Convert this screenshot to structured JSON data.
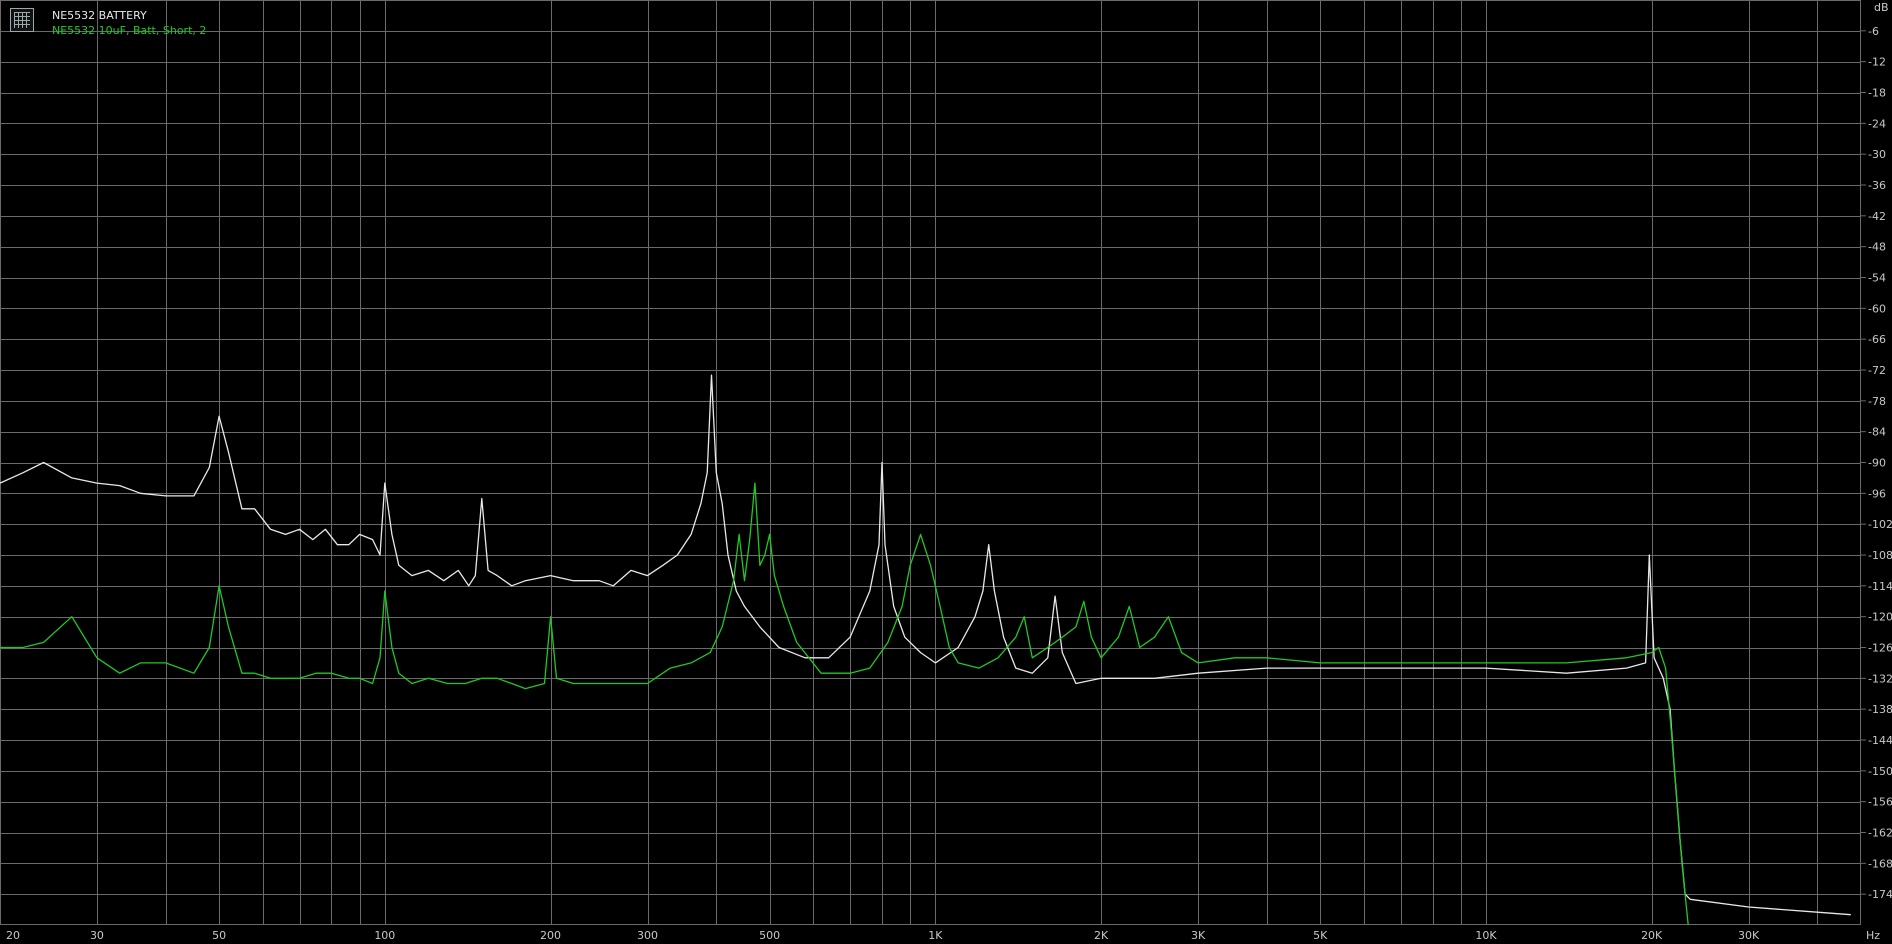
{
  "app": {
    "logo_icon": "grid-logo-icon"
  },
  "legend": {
    "series1": "NE5532 BATTERY",
    "series2": "NE5532 10uF, Batt, Short, 2"
  },
  "colors": {
    "background": "#000000",
    "grid": "#6a6a6a",
    "series1": "#e8e8e8",
    "series2": "#22c822",
    "tick_text": "#c8c8c8"
  },
  "chart_data": {
    "type": "line",
    "x_scale": "log",
    "xlim": [
      20,
      48000
    ],
    "ylim": [
      -180,
      0
    ],
    "x_unit": "Hz",
    "y_unit": "dB",
    "xticks": [
      {
        "v": 20,
        "label": "20"
      },
      {
        "v": 30,
        "label": "30"
      },
      {
        "v": 50,
        "label": "50"
      },
      {
        "v": 100,
        "label": "100"
      },
      {
        "v": 200,
        "label": "200"
      },
      {
        "v": 300,
        "label": "300"
      },
      {
        "v": 500,
        "label": "500"
      },
      {
        "v": 1000,
        "label": "1K"
      },
      {
        "v": 2000,
        "label": "2K"
      },
      {
        "v": 3000,
        "label": "3K"
      },
      {
        "v": 5000,
        "label": "5K"
      },
      {
        "v": 10000,
        "label": "10K"
      },
      {
        "v": 20000,
        "label": "20K"
      },
      {
        "v": 30000,
        "label": "30K"
      }
    ],
    "yticks": [
      -6,
      -12,
      -18,
      -24,
      -30,
      -36,
      -42,
      -48,
      -54,
      -60,
      -66,
      -72,
      -78,
      -84,
      -90,
      -96,
      -102,
      -108,
      -114,
      -120,
      -126,
      -132,
      -138,
      -144,
      -150,
      -156,
      -162,
      -168,
      -174
    ],
    "grid": true,
    "series": [
      {
        "name": "NE5532 BATTERY",
        "color": "#e8e8e8",
        "points": [
          [
            20,
            -94
          ],
          [
            22,
            -92
          ],
          [
            24,
            -90
          ],
          [
            27,
            -93
          ],
          [
            30,
            -94
          ],
          [
            33,
            -94.5
          ],
          [
            36,
            -96
          ],
          [
            40,
            -96.5
          ],
          [
            45,
            -96.5
          ],
          [
            48,
            -91
          ],
          [
            50,
            -81
          ],
          [
            52,
            -88
          ],
          [
            55,
            -99
          ],
          [
            58,
            -99
          ],
          [
            62,
            -103
          ],
          [
            66,
            -104
          ],
          [
            70,
            -103
          ],
          [
            74,
            -105
          ],
          [
            78,
            -103
          ],
          [
            82,
            -106
          ],
          [
            86,
            -106
          ],
          [
            90,
            -104
          ],
          [
            95,
            -105
          ],
          [
            98,
            -108
          ],
          [
            100,
            -94
          ],
          [
            103,
            -104
          ],
          [
            106,
            -110
          ],
          [
            112,
            -112
          ],
          [
            120,
            -111
          ],
          [
            128,
            -113
          ],
          [
            136,
            -111
          ],
          [
            142,
            -114
          ],
          [
            146,
            -112
          ],
          [
            150,
            -97
          ],
          [
            154,
            -111
          ],
          [
            160,
            -112
          ],
          [
            170,
            -114
          ],
          [
            180,
            -113
          ],
          [
            200,
            -112
          ],
          [
            220,
            -113
          ],
          [
            245,
            -113
          ],
          [
            260,
            -114
          ],
          [
            280,
            -111
          ],
          [
            300,
            -112
          ],
          [
            320,
            -110
          ],
          [
            340,
            -108
          ],
          [
            360,
            -104
          ],
          [
            375,
            -98
          ],
          [
            385,
            -92
          ],
          [
            392,
            -73
          ],
          [
            400,
            -92
          ],
          [
            410,
            -98
          ],
          [
            420,
            -108
          ],
          [
            435,
            -115
          ],
          [
            450,
            -118
          ],
          [
            480,
            -122
          ],
          [
            520,
            -126
          ],
          [
            580,
            -128
          ],
          [
            640,
            -128
          ],
          [
            700,
            -124
          ],
          [
            760,
            -115
          ],
          [
            790,
            -106
          ],
          [
            800,
            -90
          ],
          [
            810,
            -106
          ],
          [
            840,
            -118
          ],
          [
            880,
            -124
          ],
          [
            940,
            -127
          ],
          [
            1000,
            -129
          ],
          [
            1100,
            -126
          ],
          [
            1180,
            -120
          ],
          [
            1220,
            -115
          ],
          [
            1250,
            -106
          ],
          [
            1280,
            -115
          ],
          [
            1330,
            -124
          ],
          [
            1400,
            -130
          ],
          [
            1500,
            -131
          ],
          [
            1600,
            -128
          ],
          [
            1650,
            -116
          ],
          [
            1700,
            -127
          ],
          [
            1800,
            -133
          ],
          [
            2000,
            -132
          ],
          [
            2500,
            -132
          ],
          [
            3000,
            -131
          ],
          [
            4000,
            -130
          ],
          [
            5000,
            -130
          ],
          [
            7000,
            -130
          ],
          [
            10000,
            -130
          ],
          [
            14000,
            -131
          ],
          [
            18000,
            -130
          ],
          [
            19500,
            -129
          ],
          [
            19800,
            -108
          ],
          [
            20200,
            -128
          ],
          [
            21000,
            -132
          ],
          [
            21600,
            -138
          ],
          [
            22000,
            -150
          ],
          [
            22500,
            -163
          ],
          [
            23000,
            -174
          ],
          [
            23500,
            -175
          ],
          [
            30000,
            -176.5
          ],
          [
            40000,
            -177.5
          ],
          [
            46000,
            -178
          ]
        ]
      },
      {
        "name": "NE5532 10uF, Batt, Short, 2",
        "color": "#22c822",
        "points": [
          [
            20,
            -126
          ],
          [
            22,
            -126
          ],
          [
            24,
            -125
          ],
          [
            27,
            -120
          ],
          [
            30,
            -128
          ],
          [
            33,
            -131
          ],
          [
            36,
            -129
          ],
          [
            40,
            -129
          ],
          [
            45,
            -131
          ],
          [
            48,
            -126
          ],
          [
            50,
            -114
          ],
          [
            52,
            -122
          ],
          [
            55,
            -131
          ],
          [
            58,
            -131
          ],
          [
            62,
            -132
          ],
          [
            66,
            -132
          ],
          [
            70,
            -132
          ],
          [
            75,
            -131
          ],
          [
            80,
            -131
          ],
          [
            86,
            -132
          ],
          [
            90,
            -132
          ],
          [
            95,
            -133
          ],
          [
            98,
            -128
          ],
          [
            100,
            -115
          ],
          [
            103,
            -126
          ],
          [
            106,
            -131
          ],
          [
            112,
            -133
          ],
          [
            120,
            -132
          ],
          [
            130,
            -133
          ],
          [
            140,
            -133
          ],
          [
            150,
            -132
          ],
          [
            160,
            -132
          ],
          [
            170,
            -133
          ],
          [
            180,
            -134
          ],
          [
            195,
            -133
          ],
          [
            200,
            -120
          ],
          [
            205,
            -132
          ],
          [
            220,
            -133
          ],
          [
            250,
            -133
          ],
          [
            300,
            -133
          ],
          [
            330,
            -130
          ],
          [
            360,
            -129
          ],
          [
            390,
            -127
          ],
          [
            410,
            -122
          ],
          [
            430,
            -113
          ],
          [
            440,
            -104
          ],
          [
            450,
            -113
          ],
          [
            460,
            -105
          ],
          [
            470,
            -94
          ],
          [
            480,
            -110
          ],
          [
            490,
            -108
          ],
          [
            500,
            -104
          ],
          [
            510,
            -112
          ],
          [
            530,
            -118
          ],
          [
            560,
            -125
          ],
          [
            620,
            -131
          ],
          [
            700,
            -131
          ],
          [
            760,
            -130
          ],
          [
            820,
            -125
          ],
          [
            870,
            -118
          ],
          [
            900,
            -110
          ],
          [
            940,
            -104
          ],
          [
            980,
            -110
          ],
          [
            1020,
            -118
          ],
          [
            1060,
            -126
          ],
          [
            1100,
            -129
          ],
          [
            1200,
            -130
          ],
          [
            1300,
            -128
          ],
          [
            1400,
            -124
          ],
          [
            1450,
            -120
          ],
          [
            1500,
            -128
          ],
          [
            1600,
            -126
          ],
          [
            1700,
            -124
          ],
          [
            1800,
            -122
          ],
          [
            1860,
            -117
          ],
          [
            1920,
            -124
          ],
          [
            2000,
            -128
          ],
          [
            2150,
            -124
          ],
          [
            2250,
            -118
          ],
          [
            2350,
            -126
          ],
          [
            2500,
            -124
          ],
          [
            2650,
            -120
          ],
          [
            2800,
            -127
          ],
          [
            3000,
            -129
          ],
          [
            3500,
            -128
          ],
          [
            4000,
            -128
          ],
          [
            5000,
            -129
          ],
          [
            7000,
            -129
          ],
          [
            10000,
            -129
          ],
          [
            14000,
            -129
          ],
          [
            18000,
            -128
          ],
          [
            20000,
            -127
          ],
          [
            20600,
            -126
          ],
          [
            21200,
            -130
          ],
          [
            21700,
            -142
          ],
          [
            22200,
            -155
          ],
          [
            22700,
            -168
          ],
          [
            23300,
            -180
          ]
        ]
      }
    ]
  }
}
